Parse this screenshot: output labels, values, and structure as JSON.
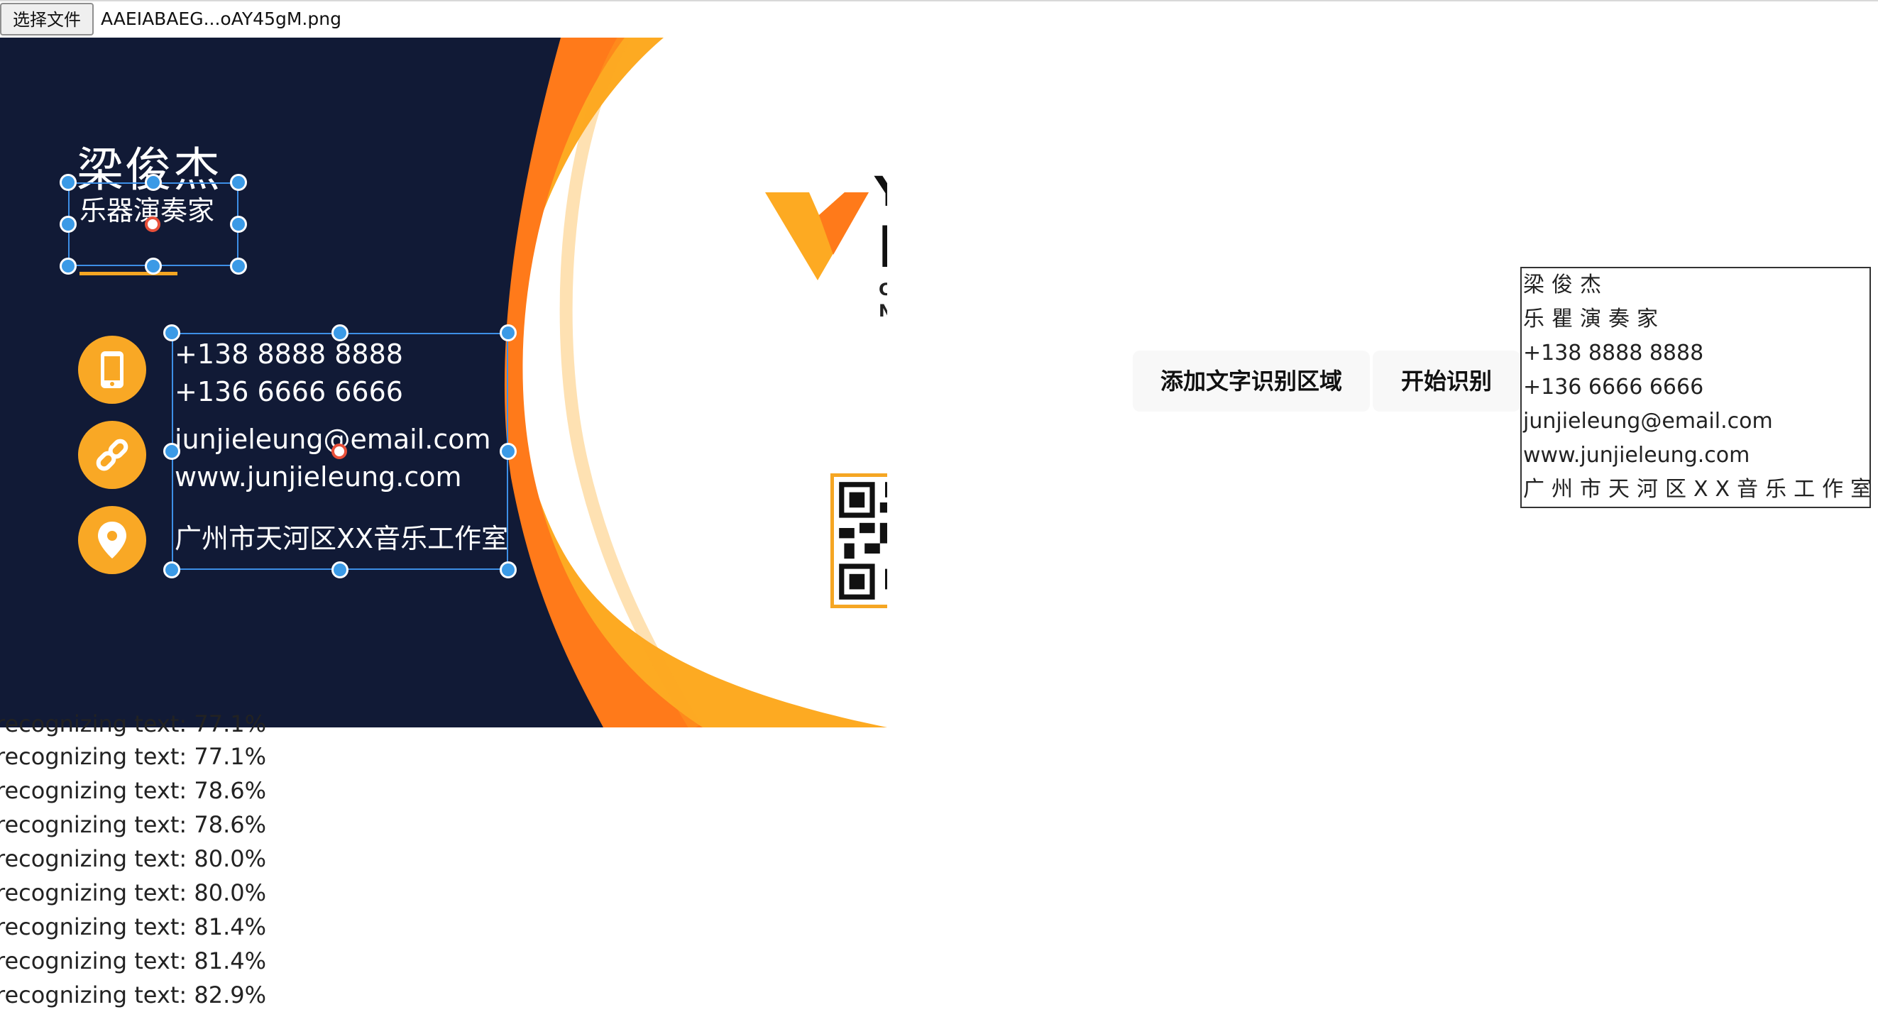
{
  "file_input": {
    "button_label": "选择文件",
    "file_name": "AAEIABAEG...oAY45gM.png"
  },
  "card": {
    "name": "梁俊杰",
    "title": "乐器演奏家",
    "phone1": "+138 8888 8888",
    "phone2": "+136 6666 6666",
    "email": "junjieleung@email.com",
    "website": "www.junjieleung.com",
    "address": "广州市天河区XX音乐工作室",
    "logo_line1": "YOUR",
    "logo_line2": "LOGO",
    "company": "COMPANY NAME",
    "colors": {
      "navy": "#111a36",
      "orange": "#ff7a1a",
      "amber": "#fdaa22"
    },
    "icons": [
      "phone-icon",
      "link-icon",
      "location-pin-icon",
      "qr-code-icon"
    ]
  },
  "buttons": {
    "add_region": "添加文字识别区域",
    "start": "开始识别"
  },
  "result_lines": [
    "梁俊杰",
    "乐瞿演奏家",
    "+138 8888 8888",
    "+136 6666 6666",
    "junjieleung@email.com",
    "www.junjieleung.com",
    "广州市天河区XX音乐工作室"
  ],
  "log_lines": [
    "recognizing text: 77.1%",
    "recognizing text: 77.1%",
    "recognizing text: 78.6%",
    "recognizing text: 78.6%",
    "recognizing text: 80.0%",
    "recognizing text: 80.0%",
    "recognizing text: 81.4%",
    "recognizing text: 81.4%",
    "recognizing text: 82.9%"
  ]
}
